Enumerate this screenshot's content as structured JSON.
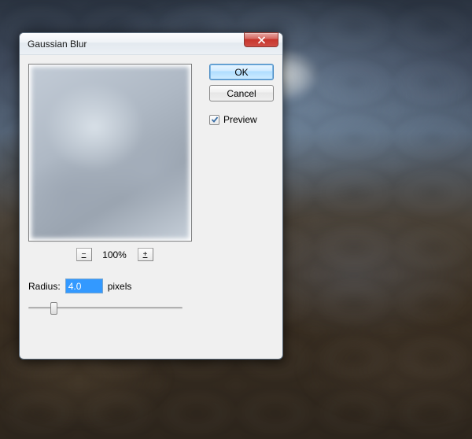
{
  "dialog": {
    "title": "Gaussian Blur",
    "ok_label": "OK",
    "cancel_label": "Cancel",
    "preview_label": "Preview",
    "preview_checked": true,
    "zoom": {
      "minus": "−",
      "plus": "+",
      "percent": "100%"
    },
    "radius": {
      "label": "Radius:",
      "value": "4.0",
      "unit": "pixels"
    }
  }
}
